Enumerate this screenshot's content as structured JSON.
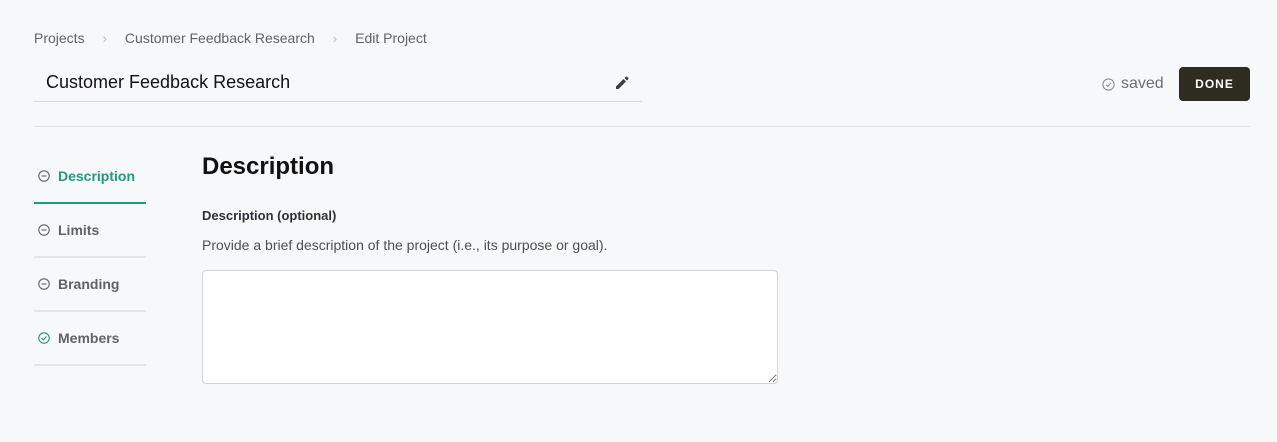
{
  "breadcrumb": {
    "items": [
      "Projects",
      "Customer Feedback Research",
      "Edit Project"
    ],
    "separator": "›"
  },
  "project": {
    "title": "Customer Feedback Research"
  },
  "header": {
    "saved_label": "saved",
    "done_label": "DONE"
  },
  "sidebar": {
    "items": [
      {
        "label": "Description",
        "status": "in-progress",
        "icon": "minus-circle-icon"
      },
      {
        "label": "Limits",
        "status": "in-progress",
        "icon": "minus-circle-icon"
      },
      {
        "label": "Branding",
        "status": "in-progress",
        "icon": "minus-circle-icon"
      },
      {
        "label": "Members",
        "status": "complete",
        "icon": "check-circle-icon"
      }
    ],
    "active_index": 0
  },
  "main": {
    "section_title": "Description",
    "field_label": "Description (optional)",
    "field_help": "Provide a brief description of the project (i.e., its purpose or goal).",
    "field_value": ""
  },
  "colors": {
    "accent": "#1f9a7d",
    "done_button": "#2e2c21",
    "background": "#f7f8fa"
  }
}
